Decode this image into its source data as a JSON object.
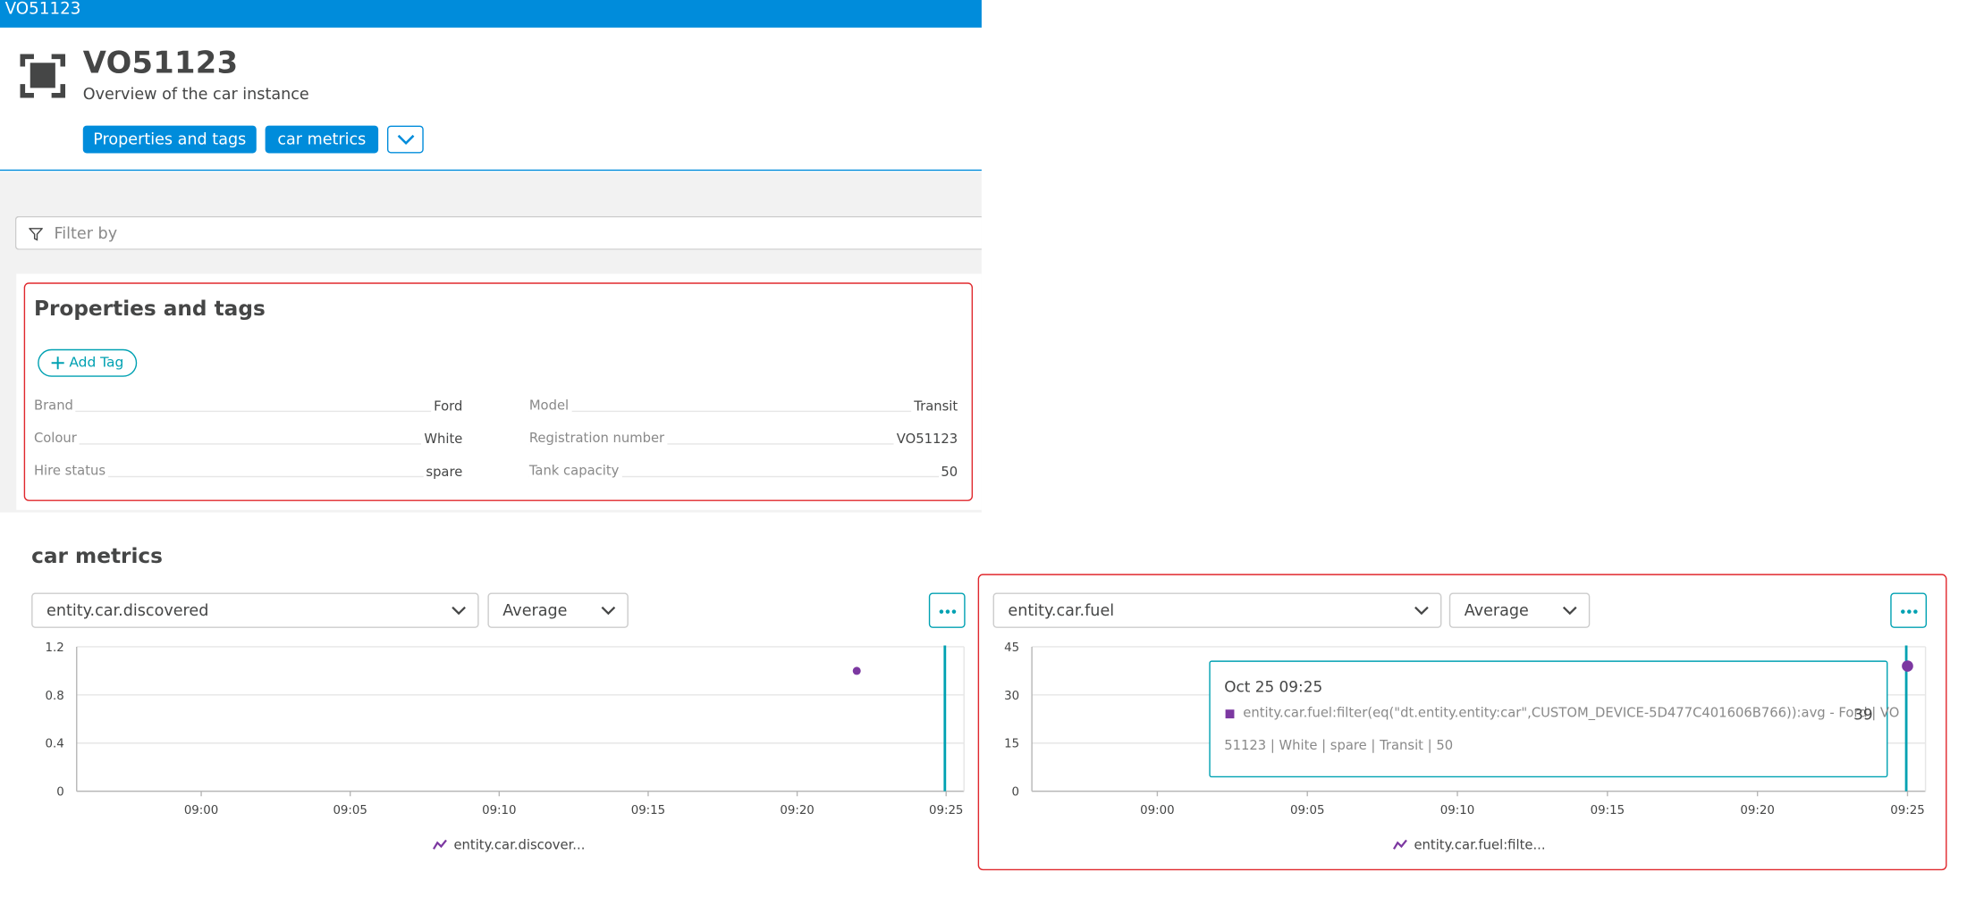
{
  "window": {
    "topbar_title": "VO51123"
  },
  "header": {
    "title": "VO51123",
    "subtitle": "Overview of the car instance",
    "buttons": [
      "Properties and tags",
      "car metrics"
    ],
    "icon": "custom-device-icon"
  },
  "filter": {
    "placeholder": "Filter by"
  },
  "properties": {
    "title": "Properties and tags",
    "add_tag_label": "Add Tag",
    "left": [
      {
        "key": "Brand",
        "value": "Ford"
      },
      {
        "key": "Colour",
        "value": "White"
      },
      {
        "key": "Hire status",
        "value": "spare"
      }
    ],
    "right": [
      {
        "key": "Model",
        "value": "Transit"
      },
      {
        "key": "Registration number",
        "value": "VO51123"
      },
      {
        "key": "Tank capacity",
        "value": "50"
      }
    ]
  },
  "metrics": {
    "title": "car metrics",
    "charts": [
      {
        "metric_select": "entity.car.discovered",
        "aggregation_select": "Average",
        "legend": "entity.car.discover...",
        "y_ticks": [
          "1.2",
          "0.8",
          "0.4",
          "0"
        ],
        "x_ticks": [
          "09:00",
          "09:05",
          "09:10",
          "09:15",
          "09:20",
          "09:25"
        ]
      },
      {
        "metric_select": "entity.car.fuel",
        "aggregation_select": "Average",
        "legend": "entity.car.fuel:filte...",
        "y_ticks": [
          "45",
          "30",
          "15",
          "0"
        ],
        "x_ticks": [
          "09:00",
          "09:05",
          "09:10",
          "09:15",
          "09:20",
          "09:25"
        ],
        "tooltip": {
          "time": "Oct 25 09:25",
          "series_line1": "entity.car.fuel:filter(eq(\"dt.entity.entity:car\",CUSTOM_DEVICE-5D477C401606B766)):avg - Ford | VO",
          "series_line2": "51123 | White | spare | Transit | 50",
          "value": "39"
        }
      }
    ]
  },
  "chart_data": [
    {
      "type": "scatter",
      "x": [
        "09:22"
      ],
      "series": [
        {
          "values": [
            1
          ]
        }
      ],
      "xticks": [
        "09:00",
        "09:05",
        "09:10",
        "09:15",
        "09:20",
        "09:25"
      ],
      "yticks": [
        0,
        0.4,
        0.8,
        1.2
      ],
      "ylim": [
        0,
        1.2
      ],
      "legend": "bottom",
      "grid": true
    },
    {
      "type": "scatter",
      "x": [
        "09:25"
      ],
      "series": [
        {
          "values": [
            39
          ]
        }
      ],
      "xticks": [
        "09:00",
        "09:05",
        "09:10",
        "09:15",
        "09:20",
        "09:25"
      ],
      "yticks": [
        0,
        15,
        30,
        45
      ],
      "ylim": [
        0,
        45
      ],
      "legend": "bottom",
      "grid": true
    }
  ],
  "colors": {
    "accent": "#008cdb",
    "teal": "#00a1b2",
    "series": "#7c38a1",
    "highlight": "#e0282d"
  }
}
